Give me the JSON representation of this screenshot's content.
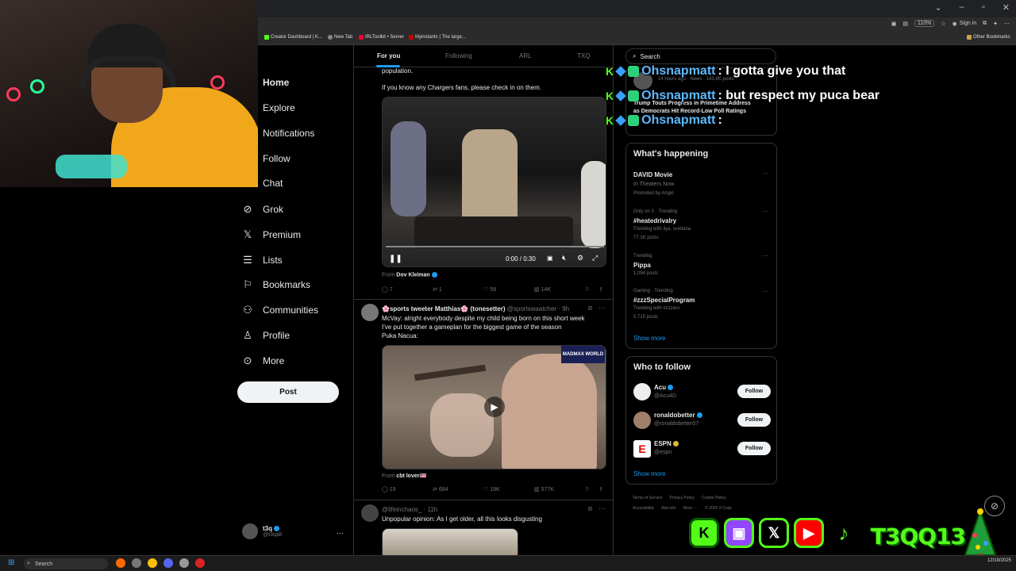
{
  "browser": {
    "zoom": "110%",
    "signin": "Sign in",
    "bookmarks": [
      "Creator Dashboard | K...",
      "New Tab",
      "IRLToolkit • Server",
      "Myinstants | The large..."
    ],
    "other_bookmarks": "Other Bookmarks"
  },
  "nav": {
    "items": [
      {
        "label": "Home",
        "icon": "home-icon"
      },
      {
        "label": "Explore",
        "icon": "search-icon"
      },
      {
        "label": "Notifications",
        "icon": "bell-icon"
      },
      {
        "label": "Follow",
        "icon": "follow-icon"
      },
      {
        "label": "Chat",
        "icon": "chat-icon"
      },
      {
        "label": "Grok",
        "icon": "grok-icon"
      },
      {
        "label": "Premium",
        "icon": "x-icon"
      },
      {
        "label": "Lists",
        "icon": "list-icon"
      },
      {
        "label": "Bookmarks",
        "icon": "bookmark-icon"
      },
      {
        "label": "Communities",
        "icon": "communities-icon"
      },
      {
        "label": "Profile",
        "icon": "profile-icon"
      },
      {
        "label": "More",
        "icon": "more-icon"
      }
    ],
    "post_button": "Post",
    "account_name": "t3q",
    "account_handle": "@t3qalt"
  },
  "timeline": {
    "tabs": [
      "For you",
      "Following",
      "ARL",
      "TXQ"
    ],
    "post1": {
      "text_top": "population.",
      "text2": "If you know any Chargers fans, please check in on them.",
      "video_time": "0:00 / 0:30",
      "from_label": "From",
      "from_name": "Dov Kleiman",
      "replies": "7",
      "reposts": "1",
      "likes": "59",
      "views": "14K"
    },
    "post2": {
      "name": "🌸sports tweeter Matthias🌸 (tonesetter)",
      "handle": "@sportswaatcher · 9h",
      "lines": [
        "McVay: alright everybody despite my child being born on this short week",
        "I've put together a gameplan for the biggest game of the season",
        "Puka Nacua:"
      ],
      "from_label": "From",
      "from_name": "cbt lover🇺🇸",
      "watermark": "MADMAX WORLD",
      "replies": "19",
      "reposts": "684",
      "likes": "19K",
      "views": "577K"
    },
    "post3": {
      "handle": "@lifeinchaos_ · 11h",
      "text": "Unpopular opinion: As I get older, all this looks disgusting"
    }
  },
  "right": {
    "search_placeholder": "Search",
    "news_meta": "14 hours ago · News · 143.8K posts",
    "news_headline_1": "Trump Touts Progress in Primetime Address",
    "news_headline_2": "as Democrats Hit Record-Low Poll Ratings",
    "whats_happening": "What's happening",
    "trends": [
      {
        "name": "DAVID Movie",
        "line2": "In Theaters Now",
        "line3": "Promoted by Angel"
      },
      {
        "meta": "Only on X · Trending",
        "name": "#heatedrivalry",
        "line3": "Trending with ilya, svetlana",
        "line4": "77.1K posts"
      },
      {
        "meta": "Trending",
        "name": "Pippa",
        "line3": "1,094 posts"
      },
      {
        "meta": "Gaming · Trending",
        "name": "#zzzSpecialProgram",
        "line3": "Trending with #zzzero",
        "line4": "5,715 posts"
      }
    ],
    "show_more": "Show more",
    "who_to_follow": "Who to follow",
    "follow_suggestions": [
      {
        "name": "Acu",
        "handle": "@Acu4D",
        "button": "Follow"
      },
      {
        "name": "ronaldobetter",
        "handle": "@ronaldobetter07",
        "button": "Follow"
      },
      {
        "name": "ESPN",
        "handle": "@espn",
        "button": "Follow"
      }
    ],
    "footer": [
      "Terms of Service",
      "Privacy Policy",
      "Cookie Policy",
      "Accessibility",
      "Ads info",
      "More ···",
      "© 2025 X Corp."
    ]
  },
  "chat": [
    {
      "user": "Ohsnapmatt",
      "message": ": I gotta give you that"
    },
    {
      "user": "Ohsnapmatt",
      "message": ": but respect my puca bear"
    },
    {
      "user": "Ohsnapmatt",
      "message": ":"
    }
  ],
  "overlay": {
    "brand": "T3QQ13",
    "socials": [
      "K",
      "twitch",
      "X",
      "youtube",
      "tiktok"
    ]
  },
  "taskbar": {
    "search": "Search",
    "time": "12/19/2025"
  },
  "colors": {
    "accent": "#1d9bf0",
    "kick_green": "#53fc18",
    "background": "#000000"
  }
}
